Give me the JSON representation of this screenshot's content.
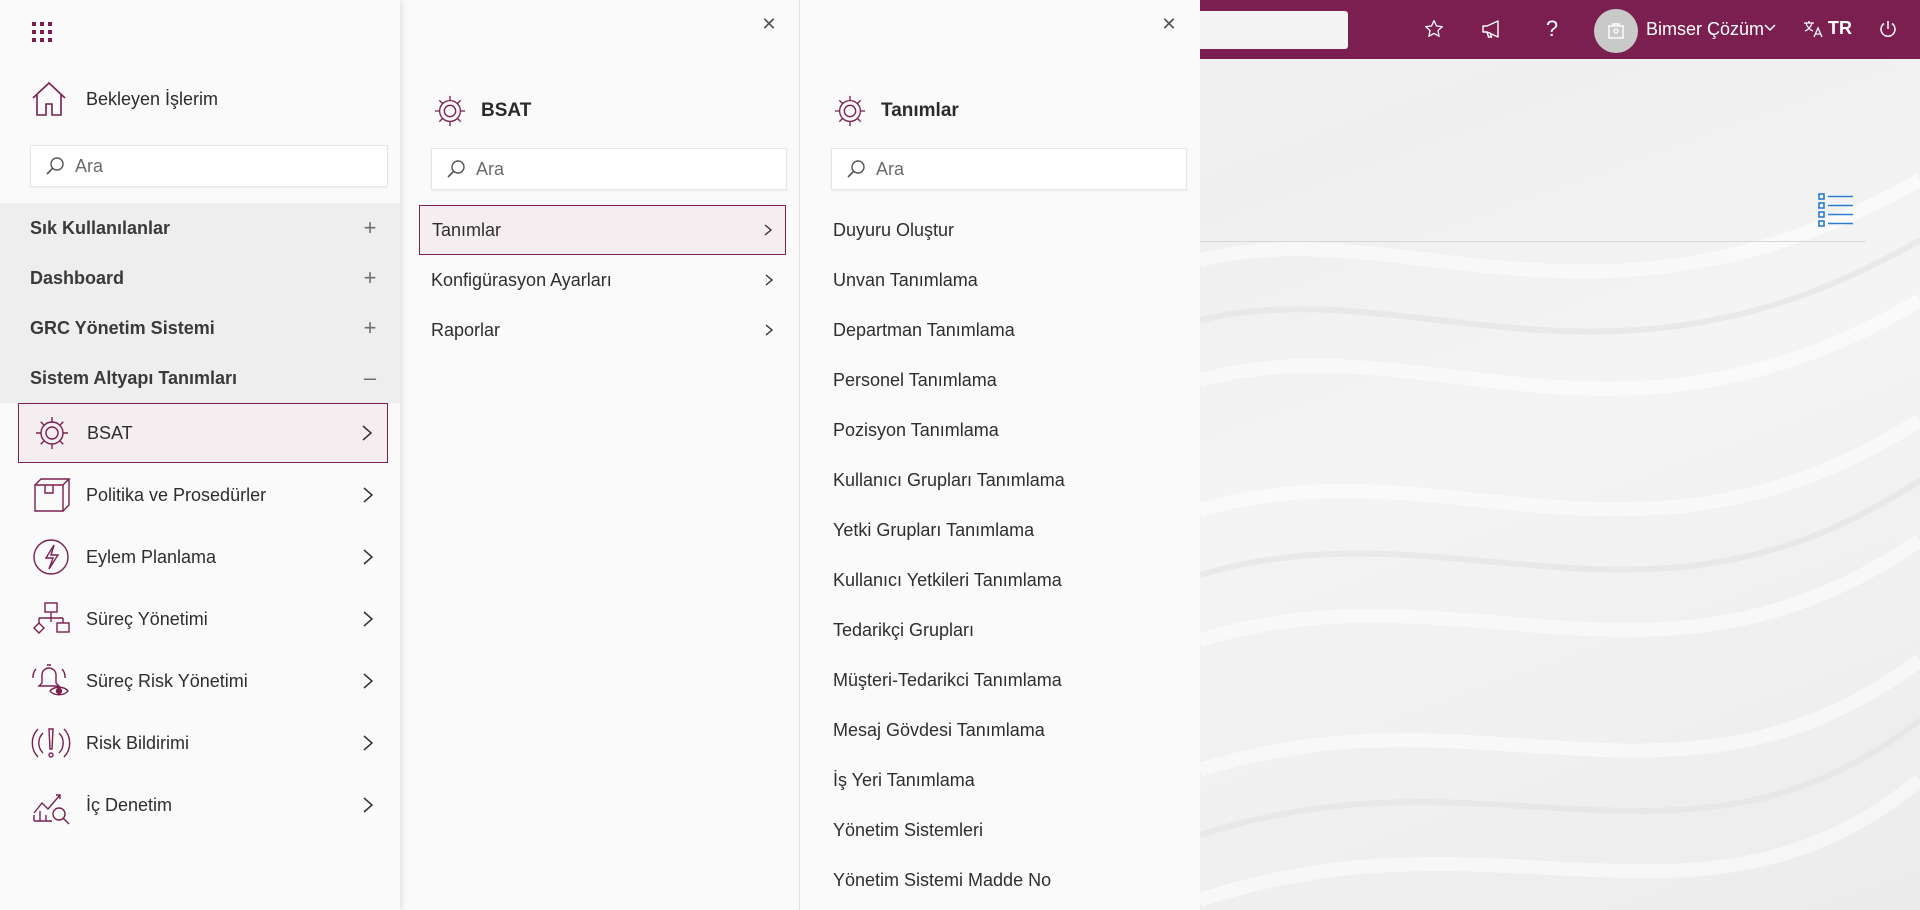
{
  "colors": {
    "brand": "#7a1f4f",
    "panel_bg": "#fafafa"
  },
  "header": {
    "user_name": "Bimser Çözüm",
    "language": "TR",
    "icons": [
      "star-icon",
      "megaphone-icon",
      "help-icon",
      "language-icon",
      "power-icon"
    ]
  },
  "menu": {
    "home_label": "Bekleyen İşlerim",
    "search_placeholder": "Ara",
    "groups": [
      {
        "label": "Sık Kullanılanlar",
        "sign": "+"
      },
      {
        "label": "Dashboard",
        "sign": "+"
      },
      {
        "label": "GRC Yönetim Sistemi",
        "sign": "+"
      },
      {
        "label": "Sistem Altyapı Tanımları",
        "sign": "–"
      }
    ],
    "modules": [
      {
        "label": "BSAT",
        "icon": "gear-icon"
      },
      {
        "label": "Politika ve Prosedürler",
        "icon": "box-icon"
      },
      {
        "label": "Eylem Planlama",
        "icon": "lightning-icon"
      },
      {
        "label": "Süreç Yönetimi",
        "icon": "process-icon"
      },
      {
        "label": "Süreç Risk Yönetimi",
        "icon": "alarm-eye-icon"
      },
      {
        "label": "Risk Bildirimi",
        "icon": "alert-signal-icon"
      },
      {
        "label": "İç Denetim",
        "icon": "chart-search-icon"
      }
    ]
  },
  "panel2": {
    "title": "BSAT",
    "search_placeholder": "Ara",
    "items": [
      "Tanımlar",
      "Konfigürasyon Ayarları",
      "Raporlar"
    ]
  },
  "panel3": {
    "title": "Tanımlar",
    "search_placeholder": "Ara",
    "items": [
      "Duyuru Oluştur",
      "Unvan Tanımlama",
      "Departman Tanımlama",
      "Personel Tanımlama",
      "Pozisyon Tanımlama",
      "Kullanıcı Grupları Tanımlama",
      "Yetki Grupları Tanımlama",
      "Kullanıcı Yetkileri Tanımlama",
      "Tedarikçi Grupları",
      "Müşteri-Tedarikci Tanımlama",
      "Mesaj Gövdesi Tanımlama",
      "İş Yeri Tanımlama",
      "Yönetim Sistemleri",
      "Yönetim Sistemi Madde No"
    ]
  }
}
